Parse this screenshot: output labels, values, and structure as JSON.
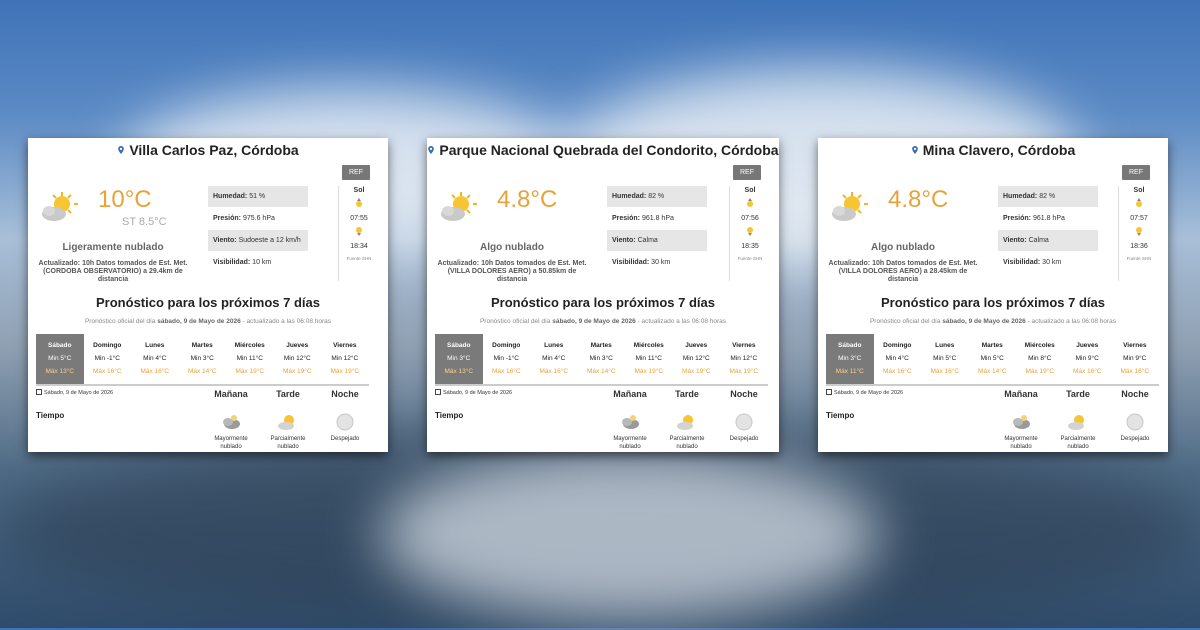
{
  "cards": [
    {
      "location": "Villa Carlos Paz, Córdoba",
      "ref": "REF",
      "temp": "10°C",
      "st": "ST 8.5°C",
      "condition": "Ligeramente nublado",
      "updated": "Actualizado: 10h Datos tomados de Est. Met. (CORDOBA OBSERVATORIO) a 29.4km de distancia",
      "stats": {
        "humidity_label": "Humedad:",
        "humidity": "51 %",
        "pressure_label": "Presión:",
        "pressure": "975.6 hPa",
        "wind_label": "Viento:",
        "wind": "Sudoeste a 12 km/h",
        "visibility_label": "Visibilidad:",
        "visibility": "10 km"
      },
      "sun": {
        "title": "Sol",
        "rise": "07:55",
        "set": "18:34",
        "source": "Fuente SHN"
      },
      "forecast_title": "Pronóstico para los próximos 7 días",
      "forecast_sub_pre": "Pronóstico oficial del día",
      "forecast_sub_date": "sábado, 9 de Mayo de 2026",
      "forecast_sub_post": "- actualizado a las 06:08 horas",
      "days": [
        {
          "name": "Sábado",
          "min": "Min 5°C",
          "max": "Máx 13°C"
        },
        {
          "name": "Domingo",
          "min": "Min -1°C",
          "max": "Máx 16°C"
        },
        {
          "name": "Lunes",
          "min": "Min 4°C",
          "max": "Máx 16°C"
        },
        {
          "name": "Martes",
          "min": "Min 3°C",
          "max": "Máx 14°C"
        },
        {
          "name": "Miércoles",
          "min": "Min 11°C",
          "max": "Máx 19°C"
        },
        {
          "name": "Jueves",
          "min": "Min 12°C",
          "max": "Máx 19°C"
        },
        {
          "name": "Viernes",
          "min": "Min 12°C",
          "max": "Máx 19°C"
        }
      ],
      "date_line": "Sábado, 9 de Mayo de 2026",
      "periods": [
        "Mañana",
        "Tarde",
        "Noche"
      ],
      "tiempo": "Tiempo",
      "period_labels": [
        "Mayormente nublado",
        "Parcialmente nublado",
        "Despejado"
      ]
    },
    {
      "location": "Parque Nacional Quebrada del Condorito, Córdoba",
      "ref": "REF",
      "temp": "4.8°C",
      "st": "",
      "condition": "Algo nublado",
      "updated": "Actualizado: 10h Datos tomados de Est. Met. (VILLA DOLORES AERO) a 50.85km de distancia",
      "stats": {
        "humidity_label": "Humedad:",
        "humidity": "82 %",
        "pressure_label": "Presión:",
        "pressure": "961.8 hPa",
        "wind_label": "Viento:",
        "wind": "Calma",
        "visibility_label": "Visibilidad:",
        "visibility": "30 km"
      },
      "sun": {
        "title": "Sol",
        "rise": "07:56",
        "set": "18:35",
        "source": "Fuente SHN"
      },
      "forecast_title": "Pronóstico para los próximos 7 días",
      "forecast_sub_pre": "Pronóstico oficial del día",
      "forecast_sub_date": "sábado, 9 de Mayo de 2026",
      "forecast_sub_post": "- actualizado a las 06:08 horas",
      "days": [
        {
          "name": "Sábado",
          "min": "Min 3°C",
          "max": "Máx 13°C"
        },
        {
          "name": "Domingo",
          "min": "Min -1°C",
          "max": "Máx 16°C"
        },
        {
          "name": "Lunes",
          "min": "Min 4°C",
          "max": "Máx 16°C"
        },
        {
          "name": "Martes",
          "min": "Min 3°C",
          "max": "Máx 14°C"
        },
        {
          "name": "Miércoles",
          "min": "Min 11°C",
          "max": "Máx 19°C"
        },
        {
          "name": "Jueves",
          "min": "Min 12°C",
          "max": "Máx 19°C"
        },
        {
          "name": "Viernes",
          "min": "Min 12°C",
          "max": "Máx 19°C"
        }
      ],
      "date_line": "Sábado, 9 de Mayo de 2026",
      "periods": [
        "Mañana",
        "Tarde",
        "Noche"
      ],
      "tiempo": "Tiempo",
      "period_labels": [
        "Mayormente nublado",
        "Parcialmente nublado",
        "Despejado"
      ]
    },
    {
      "location": "Mina Clavero, Córdoba",
      "ref": "REF",
      "temp": "4.8°C",
      "st": "",
      "condition": "Algo nublado",
      "updated": "Actualizado: 10h Datos tomados de Est. Met. (VILLA DOLORES AERO) a 28.45km de distancia",
      "stats": {
        "humidity_label": "Humedad:",
        "humidity": "82 %",
        "pressure_label": "Presión:",
        "pressure": "961.8 hPa",
        "wind_label": "Viento:",
        "wind": "Calma",
        "visibility_label": "Visibilidad:",
        "visibility": "30 km"
      },
      "sun": {
        "title": "Sol",
        "rise": "07:57",
        "set": "18:36",
        "source": "Fuente SHN"
      },
      "forecast_title": "Pronóstico para los próximos 7 días",
      "forecast_sub_pre": "Pronóstico oficial del día",
      "forecast_sub_date": "sábado, 9 de Mayo de 2026",
      "forecast_sub_post": "- actualizado a las 06:08 horas",
      "days": [
        {
          "name": "Sábado",
          "min": "Min 3°C",
          "max": "Máx 11°C"
        },
        {
          "name": "Domingo",
          "min": "Min 4°C",
          "max": "Máx 16°C"
        },
        {
          "name": "Lunes",
          "min": "Min 5°C",
          "max": "Máx 16°C"
        },
        {
          "name": "Martes",
          "min": "Min 5°C",
          "max": "Máx 14°C"
        },
        {
          "name": "Miércoles",
          "min": "Min 8°C",
          "max": "Máx 19°C"
        },
        {
          "name": "Jueves",
          "min": "Min 9°C",
          "max": "Máx 16°C"
        },
        {
          "name": "Viernes",
          "min": "Min 9°C",
          "max": "Máx 16°C"
        }
      ],
      "date_line": "Sábado, 9 de Mayo de 2026",
      "periods": [
        "Mañana",
        "Tarde",
        "Noche"
      ],
      "tiempo": "Tiempo",
      "period_labels": [
        "Mayormente nublado",
        "Parcialmente nublado",
        "Despejado"
      ]
    }
  ],
  "colors": {
    "temp": "#e8a23a",
    "selected_day": "#7a7a7a",
    "stat_grey": "#e6e6e6",
    "pin": "#3a6fb0"
  },
  "icons": {
    "location": "map-pin-icon",
    "current": "sun-cloud-icon",
    "sunrise": "sunrise-icon",
    "sunset": "sunset-icon",
    "calendar": "calendar-icon",
    "morning": "cloudy-icon",
    "afternoon": "partly-cloudy-icon",
    "night": "clear-night-icon"
  }
}
